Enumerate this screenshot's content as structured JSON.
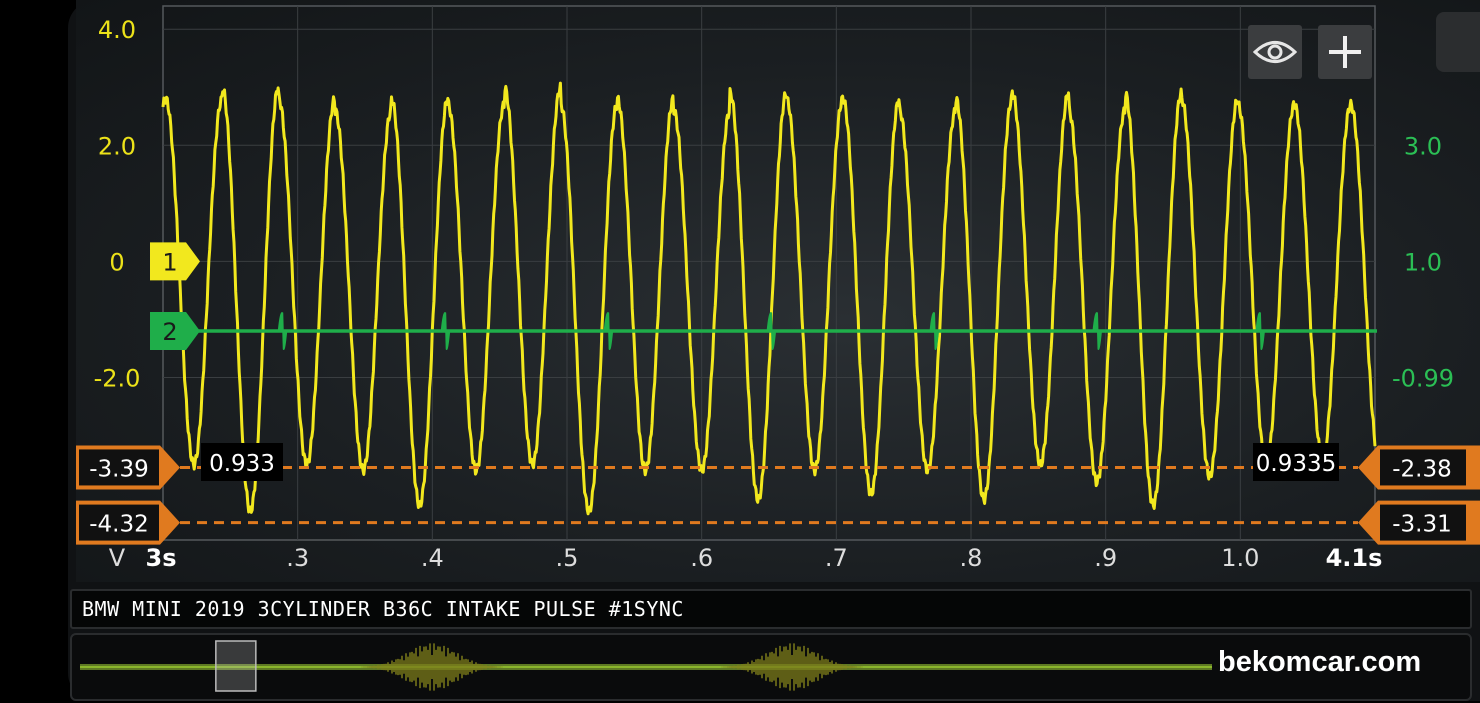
{
  "chart_data": {
    "type": "line",
    "title": "BMW MINI 2019 3CYLINDER B36C INTAKE PULSE #1SYNC",
    "xunit": "s",
    "x_start_label": "3s",
    "x_end_label": "4.1s",
    "x_ticks": [
      ".3",
      ".4",
      ".5",
      ".6",
      ".7",
      ".8",
      ".9",
      "1.0"
    ],
    "xlim": [
      3.2,
      4.1
    ],
    "grid": true,
    "left_axis": {
      "unit": "V",
      "ticks": [
        "4.0",
        "2.0",
        "0",
        "-2.0"
      ],
      "ylim": [
        -4.8,
        4.4
      ]
    },
    "right_axis": {
      "ticks": [
        "3.0",
        "1.0",
        "-0.99"
      ]
    },
    "series": [
      {
        "channel": "1",
        "color": "#f2e81e",
        "waveform": "sine",
        "peaks_approx": [
          2.8,
          3.0,
          2.8,
          2.6,
          2.8,
          2.7,
          3.0,
          2.7,
          2.8,
          2.6,
          2.9,
          2.8,
          2.8,
          2.6,
          2.8,
          2.9,
          2.6,
          2.9,
          2.8,
          2.7,
          2.7
        ],
        "troughs_approx": [
          -3.5,
          -4.3,
          -3.5,
          -3.6,
          -4.2,
          -3.6,
          -3.5,
          -4.3,
          -3.6,
          -3.6,
          -4.1,
          -3.6,
          -4.0,
          -3.6,
          -4.1,
          -3.5,
          -3.8,
          -4.2,
          -3.7,
          -3.5,
          -3.4
        ]
      },
      {
        "channel": "2",
        "color": "#1fae4a",
        "waveform": "flat-with-sync-pulses",
        "level": -1.2,
        "pulse_times": [
          3.288,
          3.409,
          3.53,
          3.651,
          3.772,
          3.893,
          4.014
        ]
      }
    ],
    "cursors": {
      "left": {
        "upper": "-3.39",
        "lower": "-4.32"
      },
      "right": {
        "upper": "-2.38",
        "lower": "-3.31"
      },
      "left_readout": "0.933",
      "right_readout": "0.9335",
      "color": "#e07a1f"
    }
  },
  "toolbar": {
    "view_icon": "eye-icon",
    "add_icon": "plus-icon"
  },
  "watermark": "bekomcar.com",
  "overview_selection": {
    "position_fraction": 0.12
  }
}
